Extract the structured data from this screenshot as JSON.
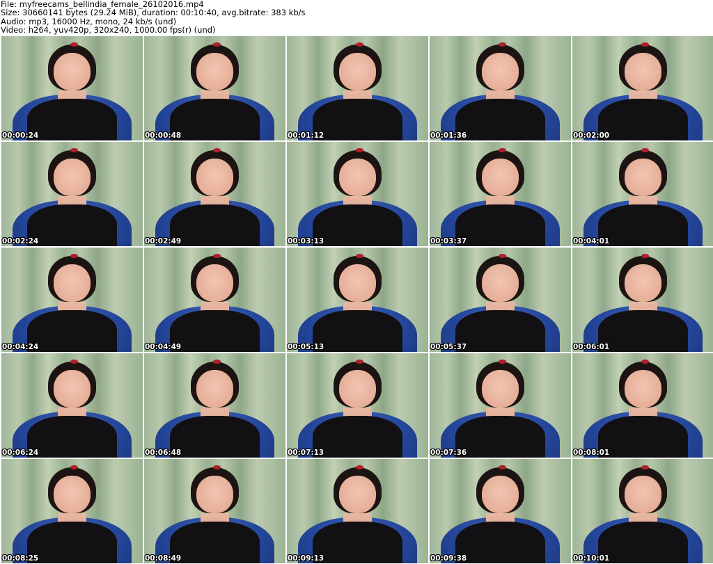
{
  "header": {
    "file": "File: myfreecams_bellindia_female_26102016.mp4",
    "size": "Size: 30660141 bytes (29.24 MiB), duration: 00:10:40, avg.bitrate: 383 kb/s",
    "audio": "Audio: mp3, 16000 Hz, mono, 24 kb/s (und)",
    "video": "Video: h264, yuv420p, 320x240, 1000.00 fps(r) (und)"
  },
  "thumbnails": [
    {
      "timestamp": "00:00:24"
    },
    {
      "timestamp": "00:00:48"
    },
    {
      "timestamp": "00:01:12"
    },
    {
      "timestamp": "00:01:36"
    },
    {
      "timestamp": "00:02:00"
    },
    {
      "timestamp": "00:02:24"
    },
    {
      "timestamp": "00:02:49"
    },
    {
      "timestamp": "00:03:13"
    },
    {
      "timestamp": "00:03:37"
    },
    {
      "timestamp": "00:04:01"
    },
    {
      "timestamp": "00:04:24"
    },
    {
      "timestamp": "00:04:49"
    },
    {
      "timestamp": "00:05:13"
    },
    {
      "timestamp": "00:05:37"
    },
    {
      "timestamp": "00:06:01"
    },
    {
      "timestamp": "00:06:24"
    },
    {
      "timestamp": "00:06:48"
    },
    {
      "timestamp": "00:07:13"
    },
    {
      "timestamp": "00:07:36"
    },
    {
      "timestamp": "00:08:01"
    },
    {
      "timestamp": "00:08:25"
    },
    {
      "timestamp": "00:08:49"
    },
    {
      "timestamp": "00:09:13"
    },
    {
      "timestamp": "00:09:38"
    },
    {
      "timestamp": "00:10:01"
    }
  ]
}
